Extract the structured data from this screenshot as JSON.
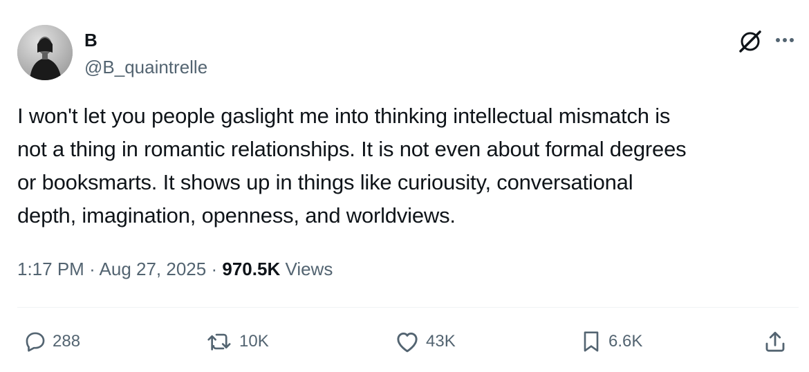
{
  "author": {
    "display_name": "B",
    "handle": "@B_quaintrelle"
  },
  "tweet": {
    "text": "I won't let you people gaslight me into thinking intellectual mismatch is\nnot a thing in romantic relationships. It is not even about formal degrees\nor booksmarts. It shows up in things like curiousity, conversational\ndepth, imagination, openness, and worldviews.",
    "time": "1:17 PM",
    "separator": "·",
    "date": "Aug 27, 2025",
    "views_count": "970.5K",
    "views_label": "Views"
  },
  "actions": {
    "replies": "288",
    "reposts": "10K",
    "likes": "43K",
    "bookmarks": "6.6K"
  },
  "icons": {
    "header": [
      "grok-icon",
      "more-icon"
    ],
    "actions": [
      "reply-icon",
      "repost-icon",
      "like-icon",
      "bookmark-icon",
      "share-icon"
    ]
  },
  "colors": {
    "text_primary": "#0f1419",
    "text_secondary": "#536471",
    "divider": "#eff3f4",
    "background": "#ffffff"
  }
}
